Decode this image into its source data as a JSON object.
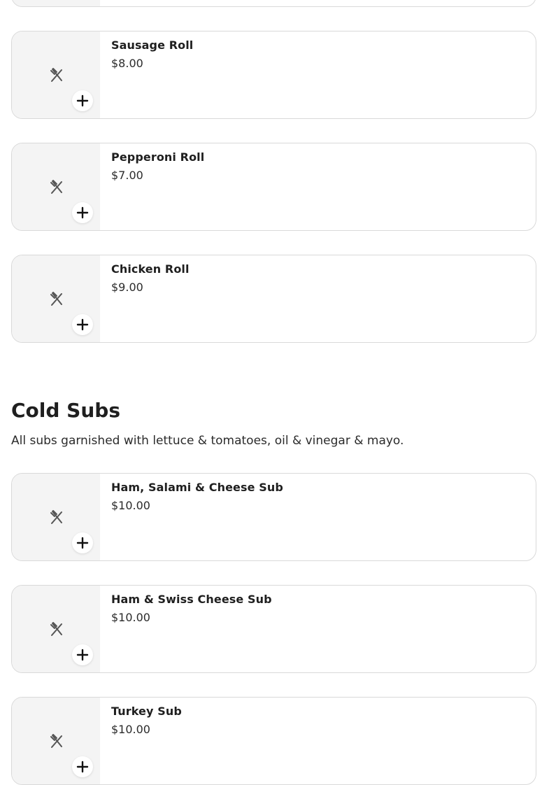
{
  "icons": {
    "item_placeholder": "fork-knife-icon",
    "add": "plus-icon"
  },
  "previous_section": {
    "items": [
      {
        "name": "Sausage Roll",
        "price": "$8.00"
      },
      {
        "name": "Pepperoni Roll",
        "price": "$7.00"
      },
      {
        "name": "Chicken Roll",
        "price": "$9.00"
      }
    ]
  },
  "cold_subs": {
    "title": "Cold Subs",
    "description": "All subs garnished with lettuce & tomatoes, oil & vinegar & mayo.",
    "items": [
      {
        "name": "Ham, Salami & Cheese Sub",
        "price": "$10.00"
      },
      {
        "name": "Ham & Swiss Cheese Sub",
        "price": "$10.00"
      },
      {
        "name": "Turkey Sub",
        "price": "$10.00"
      }
    ]
  }
}
